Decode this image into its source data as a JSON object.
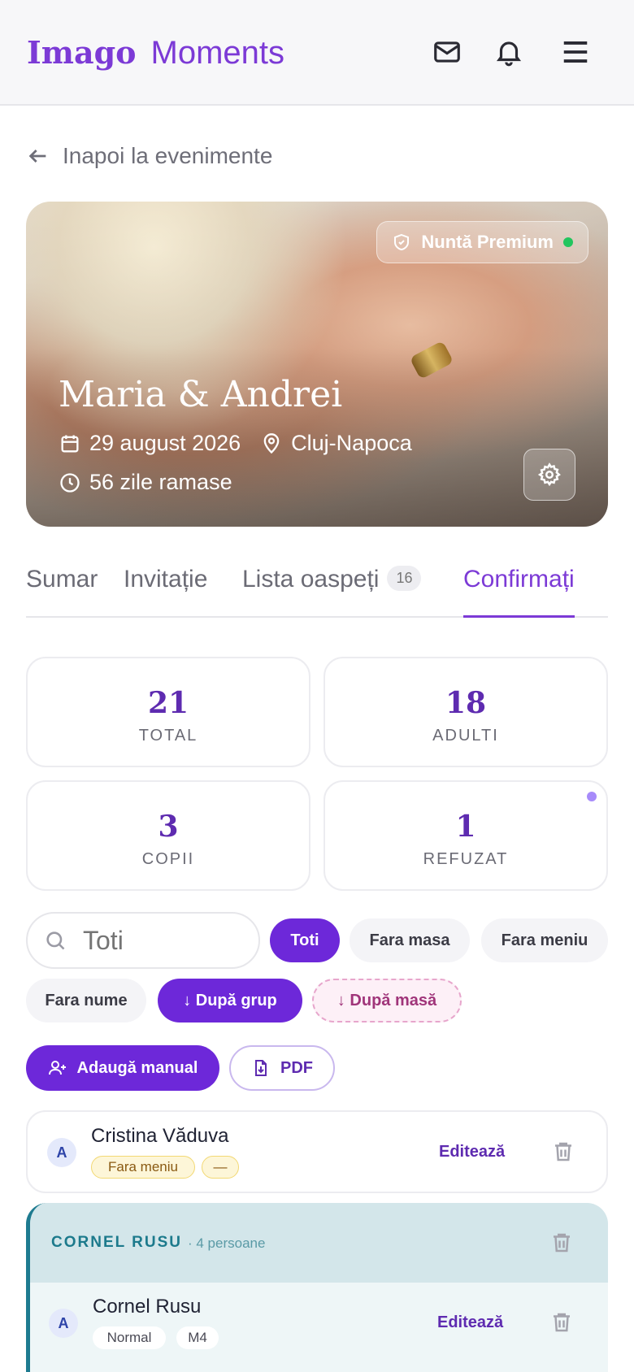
{
  "header": {
    "logo_part1": "Imago",
    "logo_part2": "Moments",
    "icons": [
      "mail-icon",
      "bell-icon",
      "menu-icon"
    ]
  },
  "back_link": "Inapoi la evenimente",
  "hero": {
    "badge": "Nuntă Premium",
    "title": "Maria & Andrei",
    "date": "29 august 2026",
    "location": "Cluj-Napoca",
    "days_left": "56 zile ramase"
  },
  "tabs": [
    {
      "label": "Sumar"
    },
    {
      "label": "Invitație"
    },
    {
      "label": "Lista oaspeți",
      "count": "16"
    },
    {
      "label": "Confirmați",
      "active": true
    }
  ],
  "stats": {
    "total": {
      "value": "21",
      "label": "TOTAL"
    },
    "adults": {
      "value": "18",
      "label": "ADULTI"
    },
    "kids": {
      "value": "3",
      "label": "COPII"
    },
    "refused": {
      "value": "1",
      "label": "REFUZAT"
    }
  },
  "search": {
    "placeholder": "Toti"
  },
  "filters": {
    "all": "Toti",
    "no_table": "Fara masa",
    "no_menu": "Fara meniu",
    "no_name": "Fara nume",
    "by_group": "↓ După grup",
    "by_table": "↓ După masă"
  },
  "actions": {
    "add_manual": "Adaugă manual",
    "pdf": "PDF"
  },
  "guests": [
    {
      "initial": "A",
      "name": "Cristina Văduva",
      "tags": [
        "Fara meniu",
        "—"
      ],
      "edit": "Editează"
    }
  ],
  "group": {
    "title": "CORNEL RUSU",
    "count": "· 4 persoane",
    "members": [
      {
        "initial": "A",
        "name": "Cornel Rusu",
        "tags": [
          "Normal",
          "M4"
        ],
        "edit": "Editează"
      }
    ]
  },
  "colors": {
    "accent": "#6d28d9",
    "brand": "#7c3ad6",
    "group": "#1e7b90",
    "online": "#22c55e"
  }
}
